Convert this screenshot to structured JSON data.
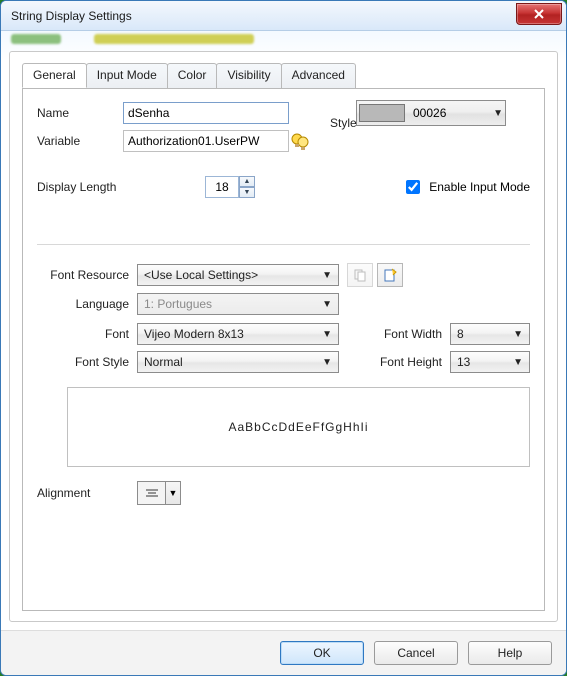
{
  "window": {
    "title": "String Display Settings"
  },
  "tabs": [
    "General",
    "Input Mode",
    "Color",
    "Visibility",
    "Advanced"
  ],
  "active_tab_index": 0,
  "general": {
    "name_label": "Name",
    "name_value": "dSenha",
    "variable_label": "Variable",
    "variable_value": "Authorization01.UserPW",
    "style_label": "Style",
    "style_swatch_color": "#b8b8b8",
    "style_value": "00026",
    "display_length_label": "Display Length",
    "display_length_value": "18",
    "enable_input_mode_label": "Enable Input Mode",
    "enable_input_mode_checked": true
  },
  "font": {
    "resource_label": "Font Resource",
    "resource_value": "<Use Local Settings>",
    "language_label": "Language",
    "language_value": "1: Portugues",
    "font_label": "Font",
    "font_value": "Vijeo Modern 8x13",
    "style_label": "Font Style",
    "style_value": "Normal",
    "width_label": "Font Width",
    "width_value": "8",
    "height_label": "Font Height",
    "height_value": "13",
    "preview_text": "AaBbCcDdEeFfGgHhIi",
    "alignment_label": "Alignment"
  },
  "buttons": {
    "ok": "OK",
    "cancel": "Cancel",
    "help": "Help"
  }
}
